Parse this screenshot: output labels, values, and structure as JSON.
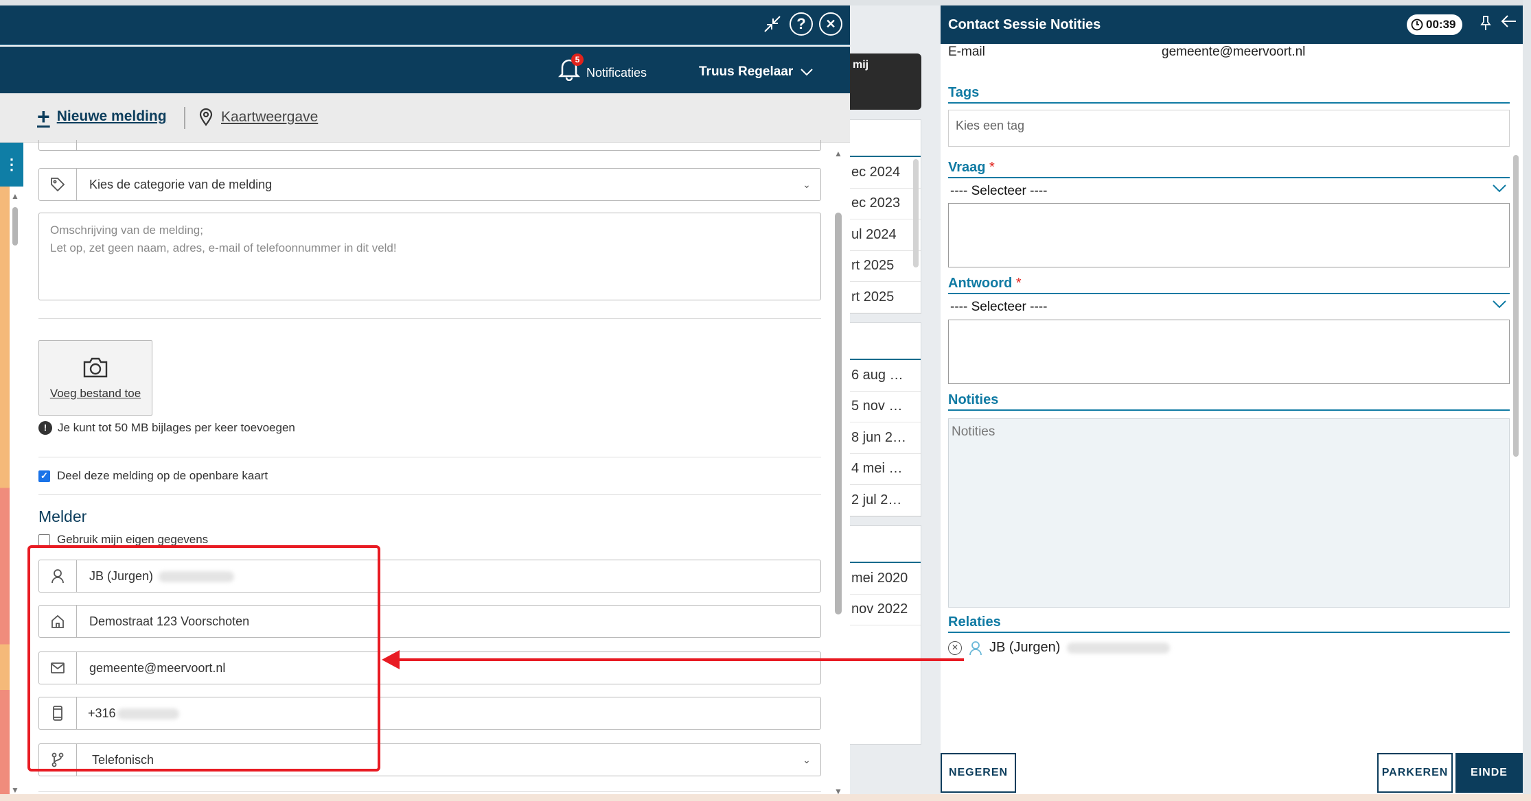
{
  "header": {
    "notifications_label": "Notificaties",
    "notifications_count": "5",
    "user_name": "Truus Regelaar"
  },
  "actions": {
    "new_report": "Nieuwe melding",
    "map_view": "Kaartweergave"
  },
  "form": {
    "category_placeholder": "Kies de categorie van de melding",
    "description_placeholder": "Omschrijving van de melding;\nLet op, zet geen naam, adres, e-mail of telefoonnummer in dit veld!",
    "upload_label": "Voeg bestand toe",
    "upload_info": "Je kunt tot 50 MB bijlages per keer toevoegen",
    "share_map_label": "Deel deze melding op de openbare kaart",
    "melder_heading": "Melder",
    "own_data_label": "Gebruik mijn eigen gegevens",
    "name_value": "JB (Jurgen)",
    "address_value": "Demostraat 123 Voorschoten",
    "email_value": "gemeente@meervoort.nl",
    "phone_value": "+316",
    "channel_value": "Telefonisch"
  },
  "middle": {
    "dark_label": "mij",
    "card1": [
      "ec 2024",
      "ec 2023",
      "ul 2024",
      "rt 2025",
      "rt 2025"
    ],
    "card2": [
      "6 aug …",
      "5 nov …",
      "8 jun 2…",
      "4 mei …",
      "2 jul 2…"
    ],
    "card3": [
      "mei 2020",
      "nov 2022"
    ]
  },
  "panel": {
    "title": "Contact Sessie Notities",
    "timer": "00:39",
    "email_label": "E-mail",
    "email_value": "gemeente@meervoort.nl",
    "tags_heading": "Tags",
    "tags_placeholder": "Kies een tag",
    "vraag_heading": "Vraag",
    "antwoord_heading": "Antwoord",
    "required_mark": "*",
    "select_placeholder": "---- Selecteer ----",
    "notities_heading": "Notities",
    "notities_placeholder": "Notities",
    "relaties_heading": "Relaties",
    "relation_name": "JB (Jurgen)",
    "btn_ignore": "NEGEREN",
    "btn_park": "PARKEREN",
    "btn_end": "EINDE"
  },
  "colors": {
    "brand_dark": "#0c3d5c",
    "accent_teal": "#0f7aa3",
    "annotation_red": "#e81b23"
  }
}
